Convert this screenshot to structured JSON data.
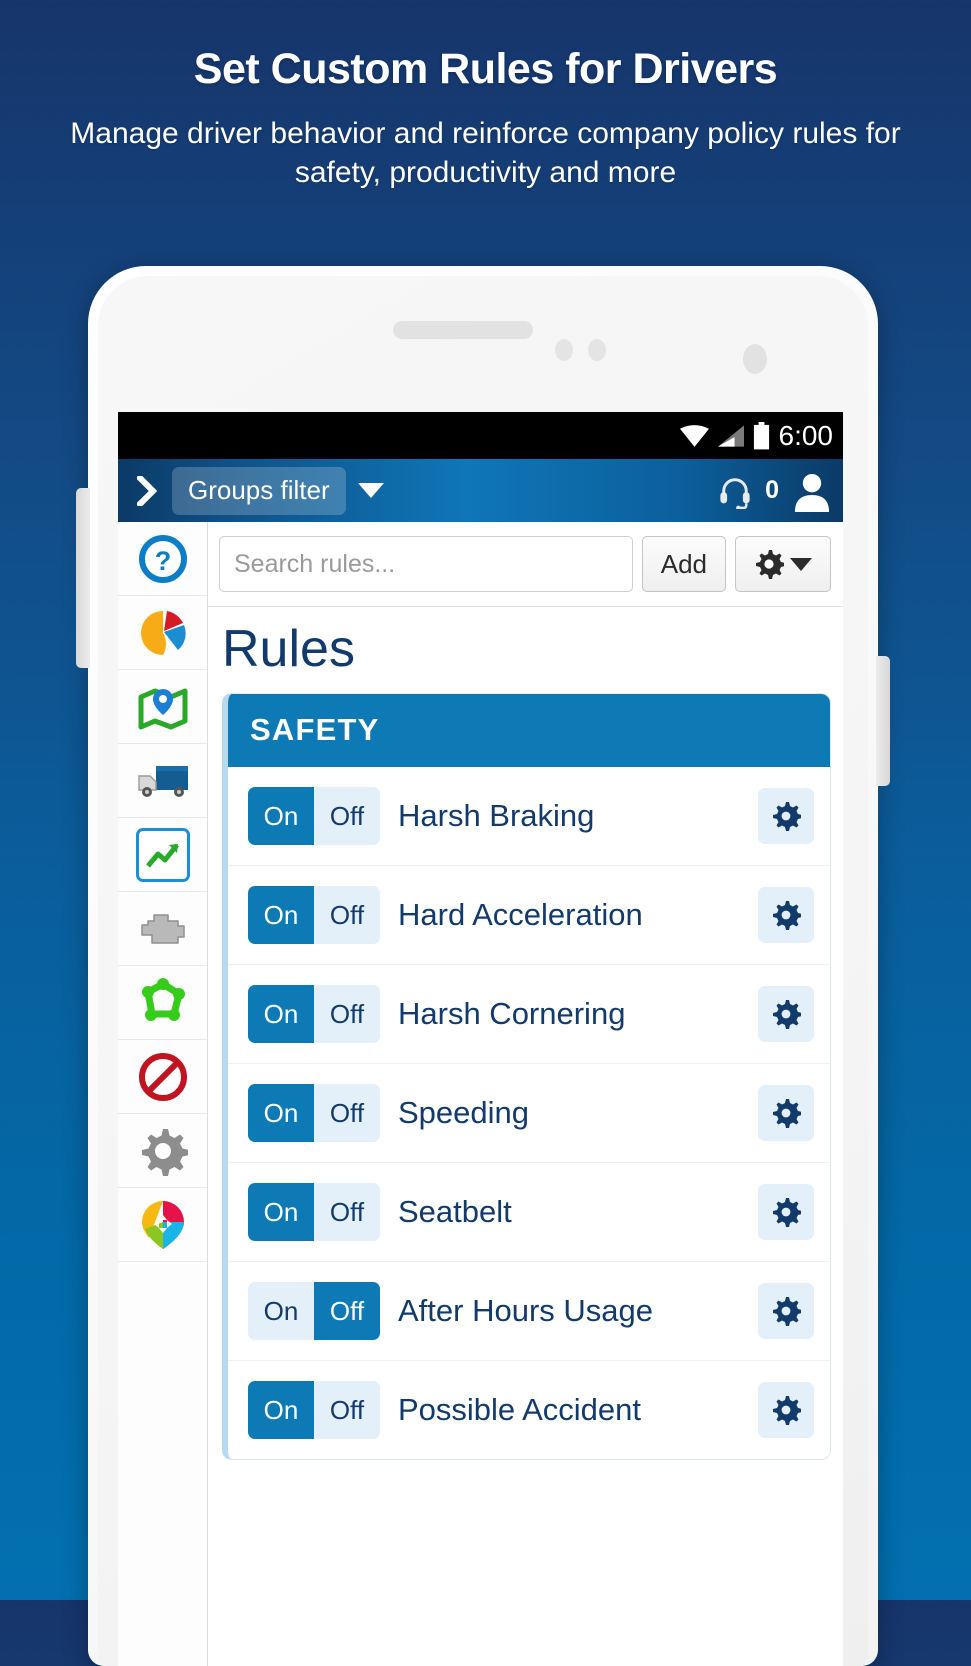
{
  "promo": {
    "title": "Set Custom Rules for Drivers",
    "subtitle": "Manage driver behavior and reinforce company policy rules for safety, productivity and more"
  },
  "colors": {
    "bg_top": "#16356b",
    "bg_bottom": "#0270b0",
    "accent_blue": "#0d7ab5",
    "navy_text": "#123a6b",
    "toggle_off_bg": "#e3f0fa",
    "card_left_border": "#b9d9ef"
  },
  "statusbar": {
    "time": "6:00",
    "icons": [
      "wifi-icon",
      "signal-icon",
      "battery-icon"
    ]
  },
  "appbar": {
    "expand_icon": "chevron-right-icon",
    "groups_filter_label": "Groups filter",
    "dropdown_icon": "caret-down-icon",
    "support_icon": "headset-icon",
    "notification_count": "0",
    "avatar_icon": "person-icon"
  },
  "sidebar": {
    "items": [
      {
        "name": "help",
        "icon": "question-circle-icon",
        "active": false
      },
      {
        "name": "dashboard",
        "icon": "pie-chart-icon",
        "active": false
      },
      {
        "name": "map",
        "icon": "map-pin-icon",
        "active": false
      },
      {
        "name": "vehicles",
        "icon": "truck-icon",
        "active": false
      },
      {
        "name": "reports",
        "icon": "chart-report-icon",
        "active": true
      },
      {
        "name": "engine",
        "icon": "engine-icon",
        "active": false
      },
      {
        "name": "zones",
        "icon": "zone-polygon-icon",
        "active": false
      },
      {
        "name": "rules",
        "icon": "prohibited-icon",
        "active": false
      },
      {
        "name": "settings",
        "icon": "gear-icon",
        "active": false
      },
      {
        "name": "marketplace",
        "icon": "colored-marker-icon",
        "active": false
      }
    ]
  },
  "toolbar": {
    "search_placeholder": "Search rules...",
    "search_value": "",
    "add_label": "Add",
    "settings_icon": "gear-icon",
    "settings_caret_icon": "caret-down-icon"
  },
  "page": {
    "title": "Rules"
  },
  "rules_card": {
    "section_header": "SAFETY",
    "toggle_on_label": "On",
    "toggle_off_label": "Off",
    "row_settings_icon": "gear-icon",
    "rows": [
      {
        "label": "Harsh Braking",
        "state": "On"
      },
      {
        "label": "Hard Acceleration",
        "state": "On"
      },
      {
        "label": "Harsh Cornering",
        "state": "On"
      },
      {
        "label": "Speeding",
        "state": "On"
      },
      {
        "label": "Seatbelt",
        "state": "On"
      },
      {
        "label": "After Hours Usage",
        "state": "Off"
      },
      {
        "label": "Possible Accident",
        "state": "On"
      }
    ]
  }
}
